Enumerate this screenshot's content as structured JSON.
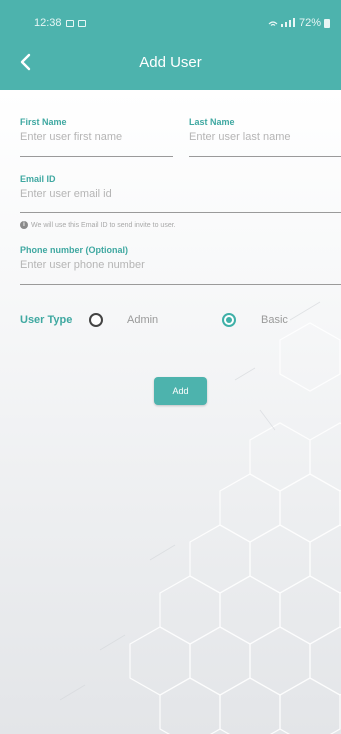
{
  "status_bar": {
    "time": "12:38",
    "battery": "72%"
  },
  "header": {
    "title": "Add User"
  },
  "form": {
    "first_name": {
      "label": "First Name",
      "placeholder": "Enter user first name"
    },
    "last_name": {
      "label": "Last Name",
      "placeholder": "Enter user last name"
    },
    "email": {
      "label": "Email ID",
      "placeholder": "Enter user email id",
      "hint": "We will use this Email ID to send invite to user."
    },
    "phone": {
      "label": "Phone number (Optional)",
      "placeholder": "Enter user phone number"
    },
    "user_type": {
      "label": "User Type",
      "options": [
        {
          "label": "Admin",
          "selected": false
        },
        {
          "label": "Basic",
          "selected": true
        }
      ]
    },
    "submit_label": "Add"
  },
  "colors": {
    "accent": "#4db3ad",
    "label": "#3fa8a1",
    "placeholder": "#b5b5b5"
  }
}
